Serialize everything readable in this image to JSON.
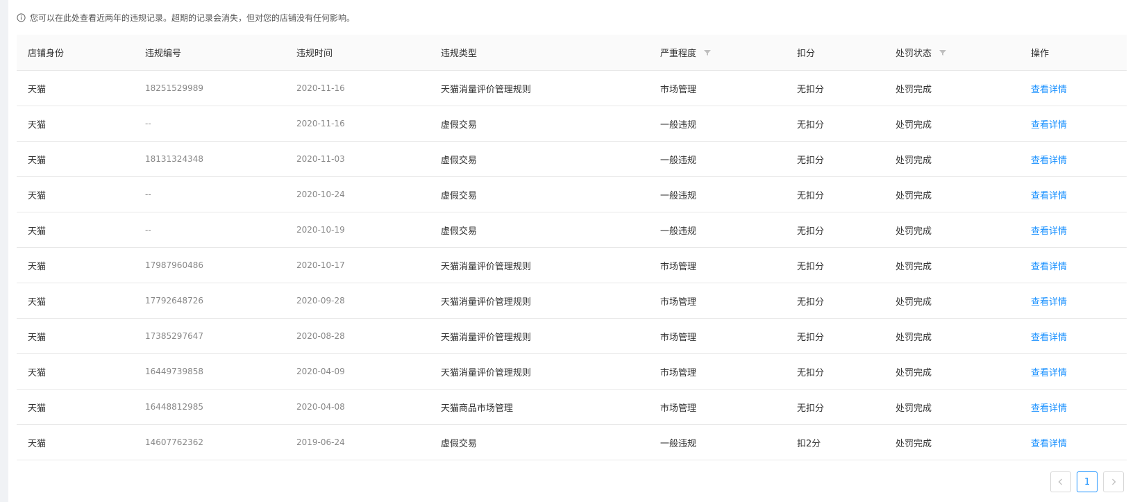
{
  "notice": {
    "text": "您可以在此处查看近两年的违规记录。超期的记录会消失，但对您的店铺没有任何影响。",
    "icon": "info-circle-icon"
  },
  "table": {
    "headers": {
      "shop": "店铺身份",
      "id": "违规编号",
      "time": "违规时间",
      "type": "违规类型",
      "severity": "严重程度",
      "points": "扣分",
      "status": "处罚状态",
      "action": "操作"
    },
    "rows": [
      {
        "shop": "天猫",
        "id": "18251529989",
        "time": "2020-11-16",
        "type": "天猫消量评价管理规则",
        "severity": "市场管理",
        "points": "无扣分",
        "status": "处罚完成",
        "action": "查看详情"
      },
      {
        "shop": "天猫",
        "id": "--",
        "time": "2020-11-16",
        "type": "虚假交易",
        "severity": "一般违规",
        "points": "无扣分",
        "status": "处罚完成",
        "action": "查看详情"
      },
      {
        "shop": "天猫",
        "id": "18131324348",
        "time": "2020-11-03",
        "type": "虚假交易",
        "severity": "一般违规",
        "points": "无扣分",
        "status": "处罚完成",
        "action": "查看详情"
      },
      {
        "shop": "天猫",
        "id": "--",
        "time": "2020-10-24",
        "type": "虚假交易",
        "severity": "一般违规",
        "points": "无扣分",
        "status": "处罚完成",
        "action": "查看详情"
      },
      {
        "shop": "天猫",
        "id": "--",
        "time": "2020-10-19",
        "type": "虚假交易",
        "severity": "一般违规",
        "points": "无扣分",
        "status": "处罚完成",
        "action": "查看详情"
      },
      {
        "shop": "天猫",
        "id": "17987960486",
        "time": "2020-10-17",
        "type": "天猫消量评价管理规则",
        "severity": "市场管理",
        "points": "无扣分",
        "status": "处罚完成",
        "action": "查看详情"
      },
      {
        "shop": "天猫",
        "id": "17792648726",
        "time": "2020-09-28",
        "type": "天猫消量评价管理规则",
        "severity": "市场管理",
        "points": "无扣分",
        "status": "处罚完成",
        "action": "查看详情"
      },
      {
        "shop": "天猫",
        "id": "17385297647",
        "time": "2020-08-28",
        "type": "天猫消量评价管理规则",
        "severity": "市场管理",
        "points": "无扣分",
        "status": "处罚完成",
        "action": "查看详情"
      },
      {
        "shop": "天猫",
        "id": "16449739858",
        "time": "2020-04-09",
        "type": "天猫消量评价管理规则",
        "severity": "市场管理",
        "points": "无扣分",
        "status": "处罚完成",
        "action": "查看详情"
      },
      {
        "shop": "天猫",
        "id": "16448812985",
        "time": "2020-04-08",
        "type": "天猫商品市场管理",
        "severity": "市场管理",
        "points": "无扣分",
        "status": "处罚完成",
        "action": "查看详情"
      },
      {
        "shop": "天猫",
        "id": "14607762362",
        "time": "2019-06-24",
        "type": "虚假交易",
        "severity": "一般违规",
        "points": "扣2分",
        "status": "处罚完成",
        "action": "查看详情"
      }
    ]
  },
  "pagination": {
    "current": "1",
    "prev_icon": "chevron-left-icon",
    "next_icon": "chevron-right-icon"
  },
  "colors": {
    "link": "#1890ff",
    "header_bg": "#fafafa",
    "border": "#e8e8e8"
  }
}
